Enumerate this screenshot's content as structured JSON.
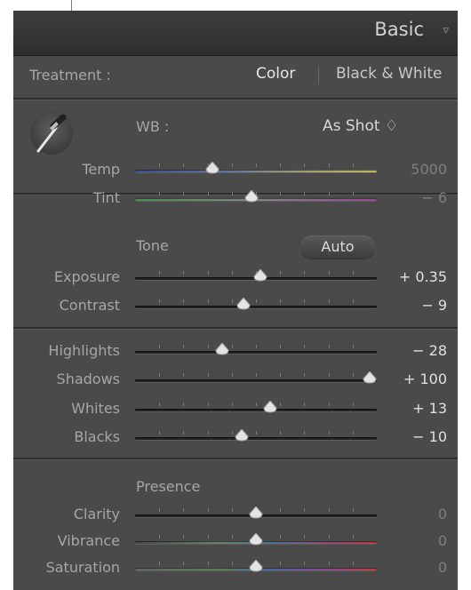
{
  "panel": {
    "title": "Basic"
  },
  "treatment": {
    "label": "Treatment :",
    "color": "Color",
    "bw": "Black & White"
  },
  "wb": {
    "label": "WB :",
    "value": "As Shot ♢"
  },
  "tone": {
    "label": "Tone",
    "auto": "Auto"
  },
  "presence": {
    "label": "Presence"
  },
  "sliders": [
    {
      "label": "Temp",
      "value": "5000",
      "pos": 0.32,
      "track": "temp",
      "dim": true
    },
    {
      "label": "Tint",
      "value": "− 6",
      "pos": 0.48,
      "track": "tint",
      "dim": true
    },
    {
      "label": "Exposure",
      "value": "+ 0.35",
      "pos": 0.52,
      "track": "dark",
      "dim": false
    },
    {
      "label": "Contrast",
      "value": "− 9",
      "pos": 0.45,
      "track": "dark",
      "dim": false
    },
    {
      "label": "Highlights",
      "value": "− 28",
      "pos": 0.36,
      "track": "dark",
      "dim": false
    },
    {
      "label": "Shadows",
      "value": "+ 100",
      "pos": 0.97,
      "track": "dark",
      "dim": false
    },
    {
      "label": "Whites",
      "value": "+ 13",
      "pos": 0.56,
      "track": "dark",
      "dim": false
    },
    {
      "label": "Blacks",
      "value": "− 10",
      "pos": 0.44,
      "track": "dark",
      "dim": false
    },
    {
      "label": "Clarity",
      "value": "0",
      "pos": 0.5,
      "track": "dark",
      "dim": true
    },
    {
      "label": "Vibrance",
      "value": "0",
      "pos": 0.5,
      "track": "vib",
      "dim": true
    },
    {
      "label": "Saturation",
      "value": "0",
      "pos": 0.5,
      "track": "sat",
      "dim": true
    }
  ]
}
